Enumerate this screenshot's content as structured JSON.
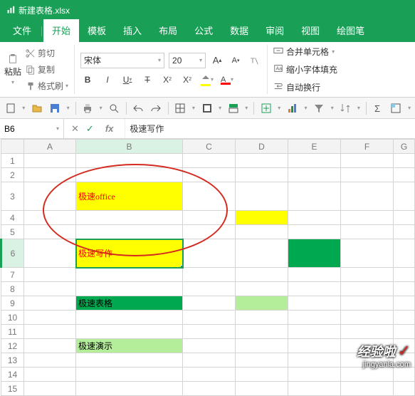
{
  "title_bar": {
    "app_icon": "chart-bar-icon",
    "filename": "新建表格.xlsx"
  },
  "tabs": {
    "items": [
      {
        "label": "文件"
      },
      {
        "label": "开始",
        "active": true
      },
      {
        "label": "模板"
      },
      {
        "label": "插入"
      },
      {
        "label": "布局"
      },
      {
        "label": "公式"
      },
      {
        "label": "数据"
      },
      {
        "label": "审阅"
      },
      {
        "label": "视图"
      },
      {
        "label": "绘图笔"
      }
    ]
  },
  "ribbon": {
    "paste": "粘贴",
    "cut": "剪切",
    "copy": "复制",
    "painter": "格式刷",
    "font_name": "宋体",
    "font_size": "20",
    "merge": "合并单元格",
    "shrink": "缩小字体填充",
    "wrap": "自动换行"
  },
  "formula_bar": {
    "cell_ref": "B6",
    "fx": "fx",
    "value": "极速写作"
  },
  "grid": {
    "cols": [
      "A",
      "B",
      "C",
      "D",
      "E",
      "F",
      "G"
    ],
    "rows": [
      "1",
      "2",
      "3",
      "4",
      "5",
      "6",
      "7",
      "8",
      "9",
      "10",
      "11",
      "12",
      "13",
      "14",
      "15"
    ],
    "selected_col": "B",
    "selected_row": "6",
    "cells": {
      "B3": "极速office",
      "B6": "极速写作",
      "B9": "极速表格",
      "B12": "极速演示"
    }
  },
  "watermark": {
    "brand": "经验啦",
    "url": "jingyanla.com"
  }
}
